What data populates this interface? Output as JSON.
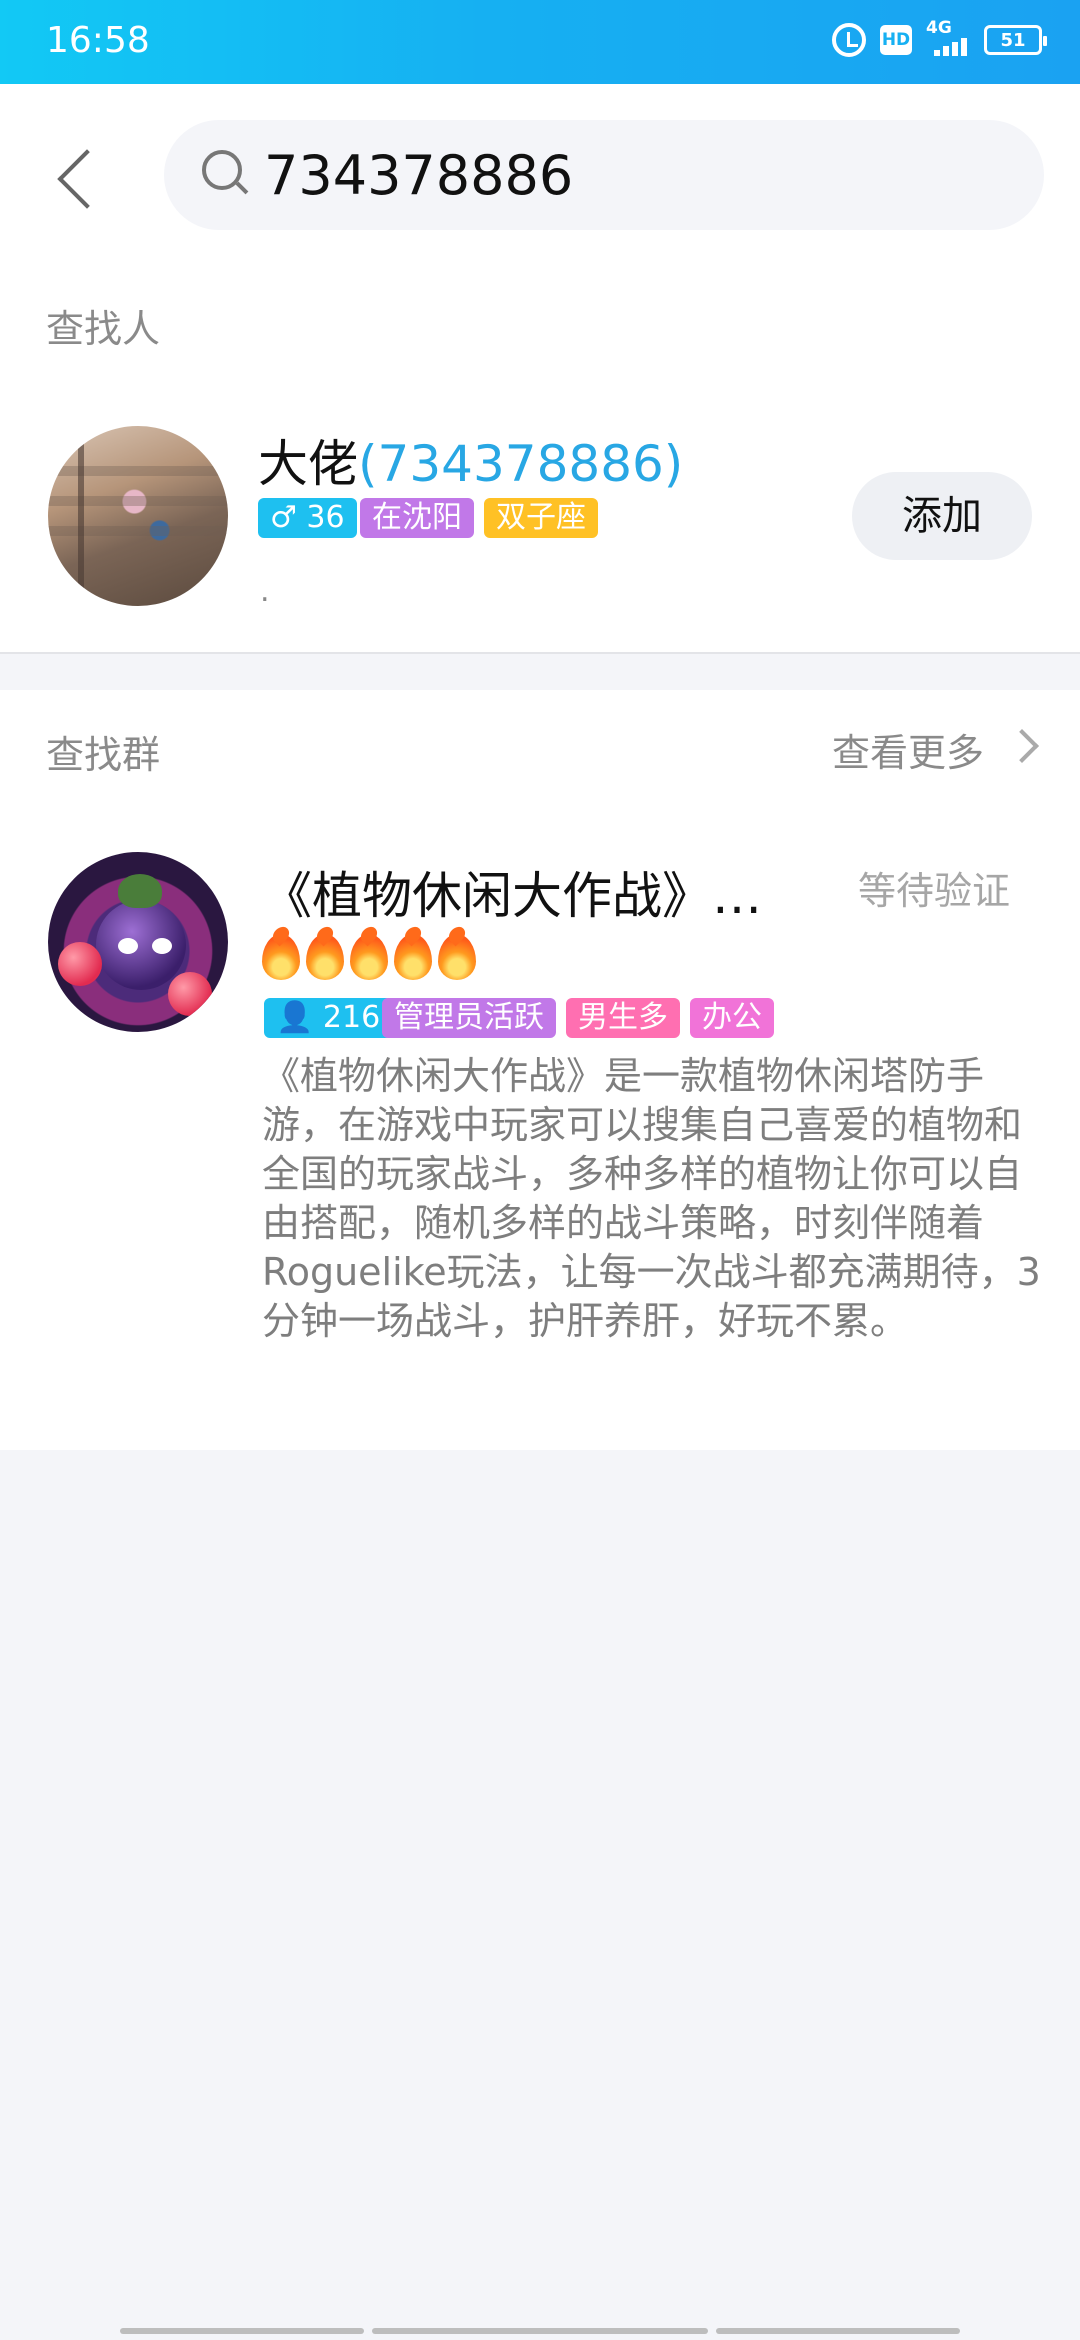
{
  "status_bar": {
    "time": "16:58",
    "hd_label": "HD",
    "network_label": "4G",
    "battery": "51"
  },
  "search": {
    "value": "734378886"
  },
  "people_section": {
    "title": "查找人",
    "user": {
      "name": "大佬",
      "id_text": "(734378886)",
      "tags": [
        {
          "text": "♂ 36",
          "color": "#1ec0f0"
        },
        {
          "text": "在沈阳",
          "color": "#c178e8"
        },
        {
          "text": "双子座",
          "color": "#ffc125"
        }
      ],
      "signature": ".",
      "add_label": "添加"
    }
  },
  "group_section": {
    "title": "查找群",
    "see_more": "查看更多",
    "group": {
      "name": "《植物休闲大作战》…",
      "status": "等待验证",
      "activity_level": 5,
      "tags": [
        {
          "text": "👤 216",
          "color": "#1ec0f0"
        },
        {
          "text": "管理员活跃",
          "color": "#c178e8"
        },
        {
          "text": "男生多",
          "color": "#ff6fb1"
        },
        {
          "text": "办公",
          "color": "#f173d8"
        }
      ],
      "description": "《植物休闲大作战》是一款植物休闲塔防手游，在游戏中玩家可以搜集自己喜爱的植物和全国的玩家战斗，多种多样的植物让你可以自由搭配，随机多样的战斗策略，时刻伴随着Roguelike玩法，让每一次战斗都充满期待，3分钟一场战斗，护肝养肝，好玩不累。"
    }
  }
}
